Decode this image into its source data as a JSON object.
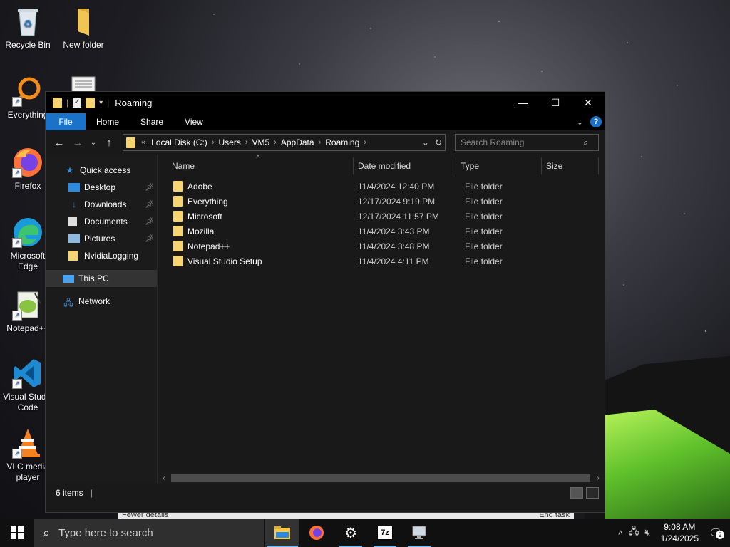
{
  "desktop": {
    "icons": [
      {
        "label": "Recycle Bin"
      },
      {
        "label": "New folder"
      },
      {
        "label": "Everything"
      },
      {
        "label": "Firefox"
      },
      {
        "label": "Microsoft Edge"
      },
      {
        "label": "Notepad++"
      },
      {
        "label": "Visual Studio Code"
      },
      {
        "label": "VLC media player"
      }
    ]
  },
  "window": {
    "title": "Roaming",
    "ribbon_tabs": [
      "File",
      "Home",
      "Share",
      "View"
    ],
    "address": {
      "overflow": "«",
      "segments": [
        "Local Disk (C:)",
        "Users",
        "VM5",
        "AppData",
        "Roaming"
      ]
    },
    "search_placeholder": "Search Roaming",
    "nav": {
      "quick_access": "Quick access",
      "quick_items": [
        "Desktop",
        "Downloads",
        "Documents",
        "Pictures",
        "NvidiaLogging"
      ],
      "this_pc": "This PC",
      "network": "Network"
    },
    "columns": [
      "Name",
      "Date modified",
      "Type",
      "Size"
    ],
    "files": [
      {
        "name": "Adobe",
        "date": "11/4/2024 12:40 PM",
        "type": "File folder",
        "size": ""
      },
      {
        "name": "Everything",
        "date": "12/17/2024 9:19 PM",
        "type": "File folder",
        "size": ""
      },
      {
        "name": "Microsoft",
        "date": "12/17/2024 11:57 PM",
        "type": "File folder",
        "size": ""
      },
      {
        "name": "Mozilla",
        "date": "11/4/2024 3:43 PM",
        "type": "File folder",
        "size": ""
      },
      {
        "name": "Notepad++",
        "date": "11/4/2024 3:48 PM",
        "type": "File folder",
        "size": ""
      },
      {
        "name": "Visual Studio Setup",
        "date": "11/4/2024 4:11 PM",
        "type": "File folder",
        "size": ""
      }
    ],
    "status": "6 items"
  },
  "behind_window": {
    "left_text": "Fewer details",
    "right_text": "End task"
  },
  "taskbar": {
    "search_placeholder": "Type here to search",
    "apps": [
      "file-explorer-icon",
      "firefox-icon",
      "settings-icon",
      "7zip-icon",
      "remote-desktop-icon"
    ],
    "time": "9:08 AM",
    "date": "1/24/2025",
    "notification_count": "2"
  },
  "colors": {
    "accent": "#1a73c8",
    "folder": "#f7d472",
    "window_bg": "#191919"
  }
}
